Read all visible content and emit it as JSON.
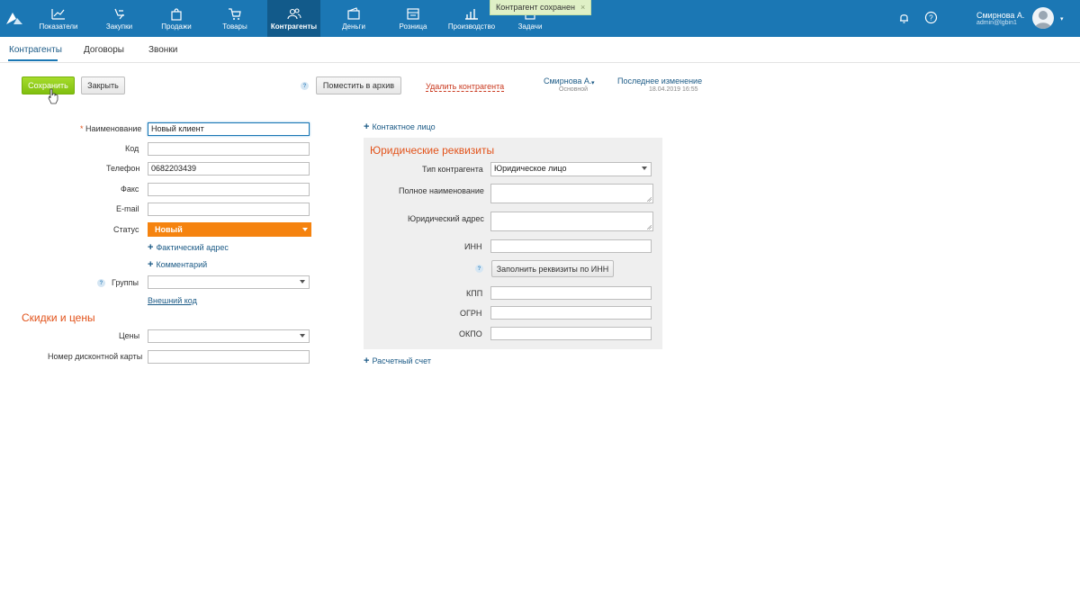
{
  "nav": {
    "items": [
      {
        "label": "Показатели",
        "icon": "chart-line-icon"
      },
      {
        "label": "Закупки",
        "icon": "purchases-icon"
      },
      {
        "label": "Продажи",
        "icon": "bag-icon"
      },
      {
        "label": "Товары",
        "icon": "cart-icon"
      },
      {
        "label": "Контрагенты",
        "icon": "people-icon",
        "active": true
      },
      {
        "label": "Деньги",
        "icon": "wallet-icon"
      },
      {
        "label": "Розница",
        "icon": "store-icon"
      },
      {
        "label": "Производство",
        "icon": "bar-chart-icon"
      },
      {
        "label": "Задачи",
        "icon": "tasks-icon"
      }
    ],
    "toast": "Контрагент сохранен",
    "toast_close": "×",
    "user": {
      "name": "Смирнова А.",
      "login": "admin@lgbin1"
    }
  },
  "subtabs": [
    "Контрагенты",
    "Договоры",
    "Звонки"
  ],
  "toolbar": {
    "save": "Сохранить",
    "close": "Закрыть",
    "help": "?",
    "archive": "Поместить в архив",
    "delete": "Удалить контрагента",
    "owner_name": "Смирнова А.",
    "owner_role": "Основной",
    "last_change_label": "Последнее изменение",
    "last_change_value": "18.04.2019 16:55"
  },
  "form": {
    "name_label": "Наименование",
    "name_value": "Новый клиент",
    "code_label": "Код",
    "code_value": "",
    "phone_label": "Телефон",
    "phone_value": "0682203439",
    "fax_label": "Факс",
    "fax_value": "",
    "email_label": "E-mail",
    "email_value": "",
    "status_label": "Статус",
    "status_value": "Новый",
    "add_address": "Фактический адрес",
    "add_comment": "Комментарий",
    "groups_label": "Группы",
    "external_code": "Внешний код",
    "discounts_title": "Скидки и цены",
    "prices_label": "Цены",
    "card_label": "Номер дисконтной карты"
  },
  "right": {
    "add_contact": "Контактное лицо",
    "legal_title": "Юридические реквизиты",
    "type_label": "Тип контрагента",
    "type_value": "Юридическое лицо",
    "fullname_label": "Полное наименование",
    "address_label": "Юридический адрес",
    "inn_label": "ИНН",
    "fill_by_inn": "Заполнить реквизиты по ИНН",
    "kpp_label": "КПП",
    "ogrn_label": "ОГРН",
    "okpo_label": "ОКПО",
    "add_account": "Расчетный счет"
  },
  "colors": {
    "topbar": "#1b77b4",
    "accent_orange": "#f5830f",
    "save_green": "#8cc918",
    "section_red": "#e2531b"
  }
}
